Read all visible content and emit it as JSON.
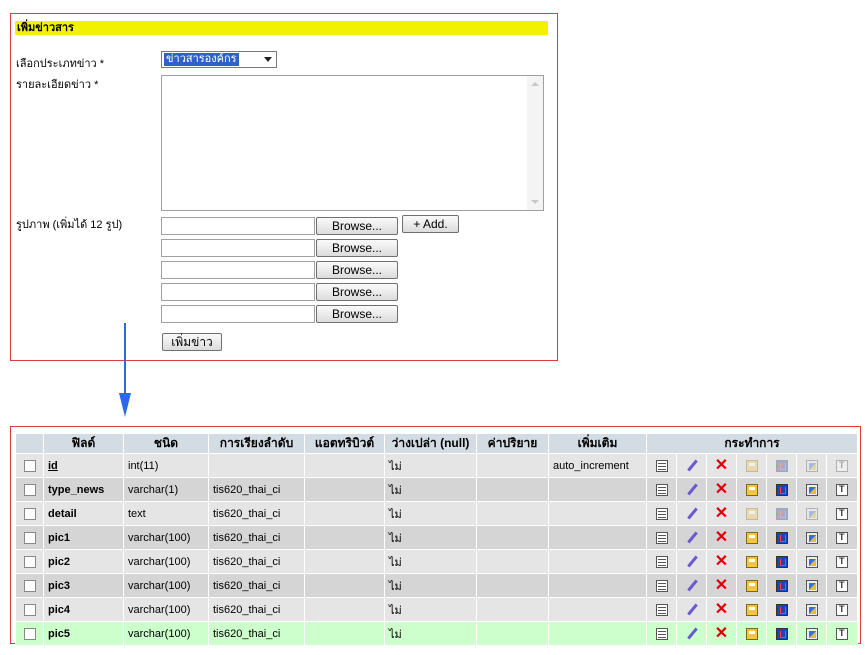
{
  "form": {
    "title": "เพิ่มข่าวสาร",
    "category_label": "เลือกประเภทข่าว *",
    "category_value": "ข่าวสารองค์กร",
    "detail_label": "รายละเอียดข่าว *",
    "images_label": "รูปภาพ (เพิ่มได้ 12 รูป)",
    "browse_label": "Browse...",
    "add_label": "+ Add.",
    "submit_label": "เพิ่มข่าว"
  },
  "table": {
    "headers": [
      "ฟิลด์",
      "ชนิด",
      "การเรียงลำดับ",
      "แอตทริบิวต์",
      "ว่างเปล่า (null)",
      "ค่าปริยาย",
      "เพิ่มเติม",
      "กระทำการ"
    ],
    "rows": [
      {
        "field": "id",
        "type": "int(11)",
        "collation": "",
        "attributes": "",
        "null": "ไม่",
        "default": "",
        "extra": "auto_increment"
      },
      {
        "field": "type_news",
        "type": "varchar(1)",
        "collation": "tis620_thai_ci",
        "attributes": "",
        "null": "ไม่",
        "default": "",
        "extra": ""
      },
      {
        "field": "detail",
        "type": "text",
        "collation": "tis620_thai_ci",
        "attributes": "",
        "null": "ไม่",
        "default": "",
        "extra": ""
      },
      {
        "field": "pic1",
        "type": "varchar(100)",
        "collation": "tis620_thai_ci",
        "attributes": "",
        "null": "ไม่",
        "default": "",
        "extra": ""
      },
      {
        "field": "pic2",
        "type": "varchar(100)",
        "collation": "tis620_thai_ci",
        "attributes": "",
        "null": "ไม่",
        "default": "",
        "extra": ""
      },
      {
        "field": "pic3",
        "type": "varchar(100)",
        "collation": "tis620_thai_ci",
        "attributes": "",
        "null": "ไม่",
        "default": "",
        "extra": ""
      },
      {
        "field": "pic4",
        "type": "varchar(100)",
        "collation": "tis620_thai_ci",
        "attributes": "",
        "null": "ไม่",
        "default": "",
        "extra": ""
      },
      {
        "field": "pic5",
        "type": "varchar(100)",
        "collation": "tis620_thai_ci",
        "attributes": "",
        "null": "ไม่",
        "default": "",
        "extra": ""
      }
    ],
    "action_icons": [
      "browse-icon",
      "edit-icon",
      "drop-icon",
      "primary-key-icon",
      "unique-icon",
      "index-icon",
      "fulltext-icon"
    ],
    "highlight_color": "#ccffcc"
  },
  "colors": {
    "border_red": "#e03a3a",
    "title_yellow": "#f2f200",
    "arrow_blue": "#2a6ae6",
    "header_bg": "#d3dce3"
  }
}
